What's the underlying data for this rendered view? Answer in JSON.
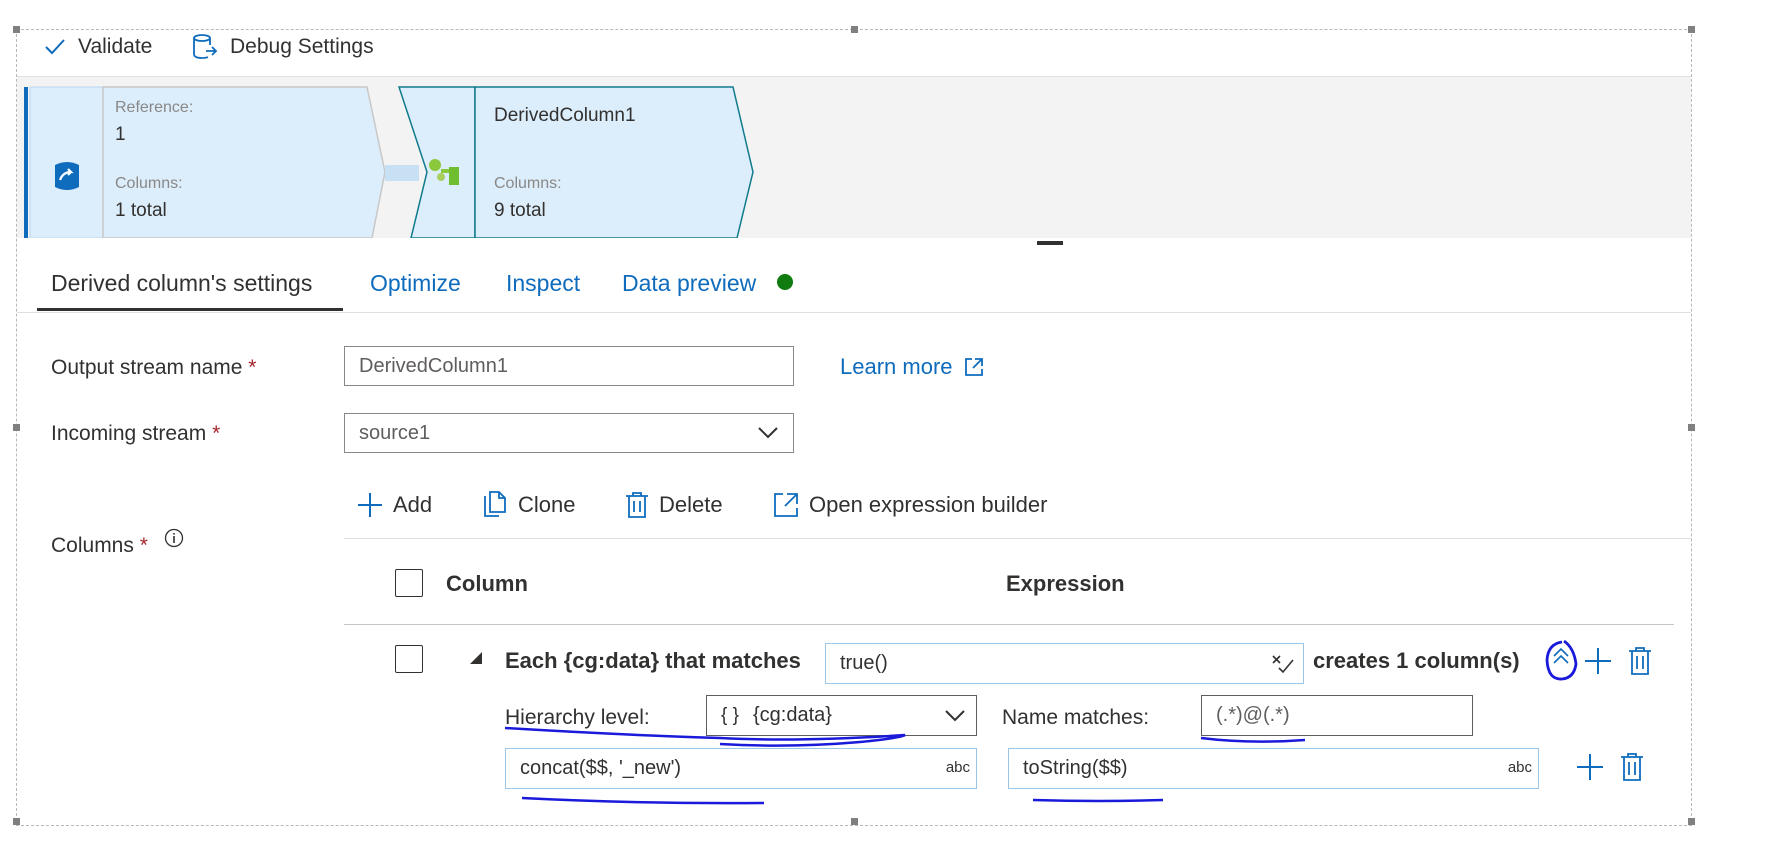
{
  "toolbar": {
    "validate_label": "Validate",
    "debug_settings_label": "Debug Settings"
  },
  "canvas": {
    "source_node": {
      "reference_label": "Reference:",
      "reference_value": "1",
      "columns_label": "Columns:",
      "columns_value": "1 total",
      "icon": "data-source-icon"
    },
    "derived_node": {
      "name": "DerivedColumn1",
      "columns_label": "Columns:",
      "columns_value": "9 total",
      "icon": "derived-column-icon"
    }
  },
  "tabs": [
    {
      "label": "Derived column's settings",
      "active": true
    },
    {
      "label": "Optimize",
      "active": false
    },
    {
      "label": "Inspect",
      "active": false
    },
    {
      "label": "Data preview",
      "active": false
    }
  ],
  "status_dot_color": "#107c10",
  "form": {
    "output_stream_label": "Output stream name",
    "output_stream_value": "DerivedColumn1",
    "incoming_stream_label": "Incoming stream",
    "incoming_stream_value": "source1",
    "columns_label": "Columns",
    "required_mark": "*",
    "learn_more": "Learn more"
  },
  "commands": {
    "add": "Add",
    "clone": "Clone",
    "delete": "Delete",
    "open_builder": "Open expression builder"
  },
  "table": {
    "column_header": "Column",
    "expression_header": "Expression",
    "pattern_row": {
      "prefix": "Each {cg:data} that matches",
      "condition": "true()",
      "suffix": "creates 1 column(s)",
      "hierarchy_label": "Hierarchy level:",
      "hierarchy_glyph": "{ }",
      "hierarchy_value": "{cg:data}",
      "name_matches_label": "Name matches:",
      "name_matches_value": "(.*)@(.*)",
      "column_expr": "concat($$, '_new')",
      "value_expr": "toString($$)",
      "type_badge": "abc"
    }
  },
  "colors": {
    "accent": "#0f6cbd",
    "annotation_ink": "#1a1adb",
    "node_fill": "#dcedfb",
    "node_stroke": "#0f7b8c",
    "required": "#a4262c"
  }
}
